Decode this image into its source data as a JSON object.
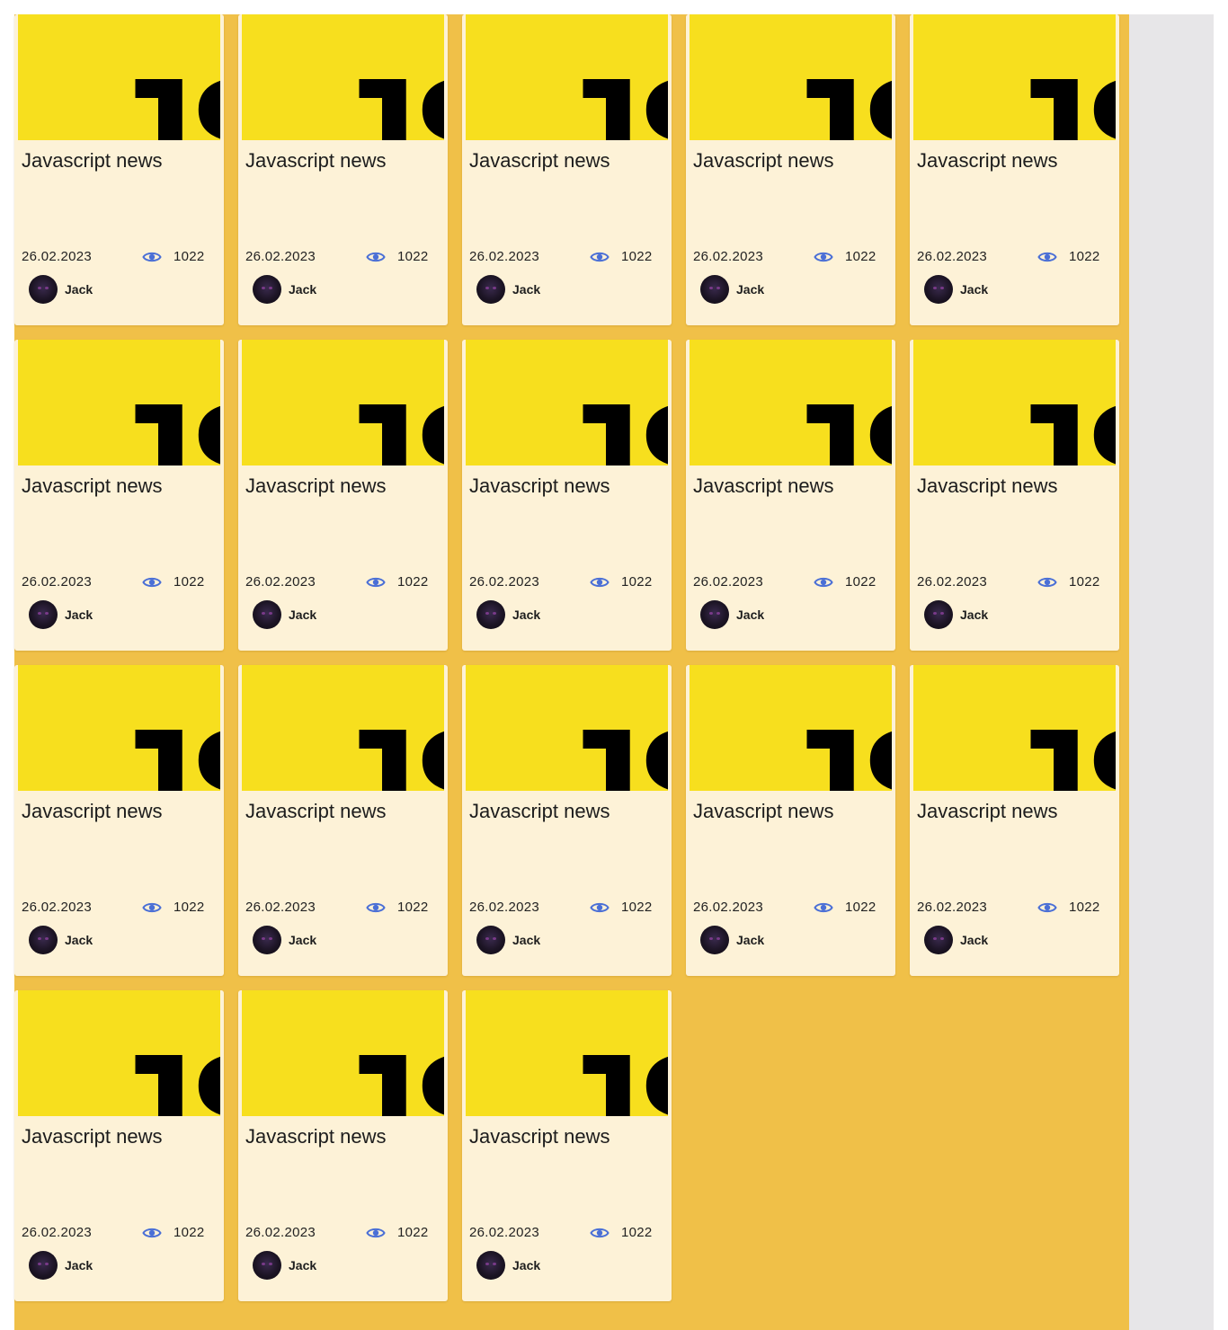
{
  "news": {
    "items": [
      {
        "title": "Javascript news",
        "date": "26.02.2023",
        "views": "1022",
        "author": "Jack",
        "image_text": "JS"
      },
      {
        "title": "Javascript news",
        "date": "26.02.2023",
        "views": "1022",
        "author": "Jack",
        "image_text": "JS"
      },
      {
        "title": "Javascript news",
        "date": "26.02.2023",
        "views": "1022",
        "author": "Jack",
        "image_text": "JS"
      },
      {
        "title": "Javascript news",
        "date": "26.02.2023",
        "views": "1022",
        "author": "Jack",
        "image_text": "JS"
      },
      {
        "title": "Javascript news",
        "date": "26.02.2023",
        "views": "1022",
        "author": "Jack",
        "image_text": "JS"
      },
      {
        "title": "Javascript news",
        "date": "26.02.2023",
        "views": "1022",
        "author": "Jack",
        "image_text": "JS"
      },
      {
        "title": "Javascript news",
        "date": "26.02.2023",
        "views": "1022",
        "author": "Jack",
        "image_text": "JS"
      },
      {
        "title": "Javascript news",
        "date": "26.02.2023",
        "views": "1022",
        "author": "Jack",
        "image_text": "JS"
      },
      {
        "title": "Javascript news",
        "date": "26.02.2023",
        "views": "1022",
        "author": "Jack",
        "image_text": "JS"
      },
      {
        "title": "Javascript news",
        "date": "26.02.2023",
        "views": "1022",
        "author": "Jack",
        "image_text": "JS"
      },
      {
        "title": "Javascript news",
        "date": "26.02.2023",
        "views": "1022",
        "author": "Jack",
        "image_text": "JS"
      },
      {
        "title": "Javascript news",
        "date": "26.02.2023",
        "views": "1022",
        "author": "Jack",
        "image_text": "JS"
      },
      {
        "title": "Javascript news",
        "date": "26.02.2023",
        "views": "1022",
        "author": "Jack",
        "image_text": "JS"
      },
      {
        "title": "Javascript news",
        "date": "26.02.2023",
        "views": "1022",
        "author": "Jack",
        "image_text": "JS"
      },
      {
        "title": "Javascript news",
        "date": "26.02.2023",
        "views": "1022",
        "author": "Jack",
        "image_text": "JS"
      },
      {
        "title": "Javascript news",
        "date": "26.02.2023",
        "views": "1022",
        "author": "Jack",
        "image_text": "JS"
      },
      {
        "title": "Javascript news",
        "date": "26.02.2023",
        "views": "1022",
        "author": "Jack",
        "image_text": "JS"
      },
      {
        "title": "Javascript news",
        "date": "26.02.2023",
        "views": "1022",
        "author": "Jack",
        "image_text": "JS"
      }
    ]
  },
  "icons": {
    "views": "eye-icon",
    "avatar": "avatar-image"
  },
  "colors": {
    "page_background": "#f0c048",
    "card_background": "#fdf2d7",
    "js_yellow": "#f7df1e",
    "eye_icon": "#4a6fd6",
    "side_panel": "#e7e6e8"
  }
}
